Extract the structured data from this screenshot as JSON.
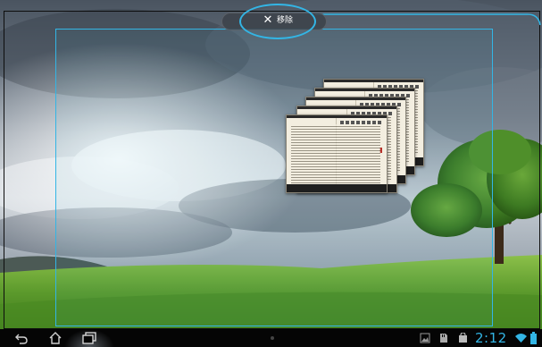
{
  "drop_target": {
    "label": "移除",
    "icon": "close-icon"
  },
  "widget": {
    "name": "ebook-reader-widget",
    "pages": 5
  },
  "navigation": {
    "back_icon": "back-icon",
    "home_icon": "home-icon",
    "recent_icon": "recent-apps-icon"
  },
  "status_bar": {
    "time": "2:12",
    "icons": [
      "gallery-icon",
      "sd-card-icon",
      "shopping-bag-icon",
      "wifi-icon",
      "battery-icon"
    ],
    "accent_color": "#33b5e5"
  },
  "colors": {
    "highlight": "#33b5e5",
    "nav_bg": "#050505"
  }
}
